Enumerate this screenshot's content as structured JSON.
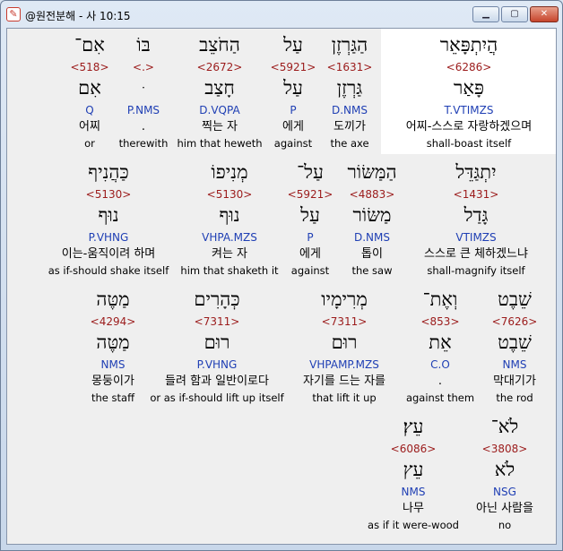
{
  "window": {
    "title": "@원전분해 - 사 10:15",
    "app_icon_glyph": "✎",
    "min_glyph": "▁",
    "max_glyph": "▢",
    "close_glyph": "✕"
  },
  "rows": [
    {
      "words": [
        {
          "hebrew": "אִם־",
          "strong": "<518>",
          "lemma": "אִם",
          "morph": "Q",
          "korean": "어찌",
          "english": "or"
        },
        {
          "hebrew": "בּוֹ",
          "strong": "<.>",
          "lemma": "ּ",
          "morph": "P.NMS",
          "korean": ".",
          "english": "therewith"
        },
        {
          "hebrew": "הַחֹצֵב",
          "strong": "<2672>",
          "lemma": "חָצַב",
          "morph": "D.VQPA",
          "korean": "찍는 자",
          "english": "him that heweth"
        },
        {
          "hebrew": "עַל",
          "strong": "<5921>",
          "lemma": "עַל",
          "morph": "P",
          "korean": "에게",
          "english": "against"
        },
        {
          "hebrew": "הַגַּרְזֶן",
          "strong": "<1631>",
          "lemma": "גַּרְזֶן",
          "morph": "D.NMS",
          "korean": "도끼가",
          "english": "the axe"
        },
        {
          "hebrew": "הֲיִתְפָּאֵר",
          "strong": "<6286>",
          "lemma": "פָּאַר",
          "morph": "T.VTIMZS",
          "korean": "어찌-스스로 자랑하겠으며",
          "english": "shall-boast itself"
        }
      ]
    },
    {
      "words": [
        {
          "hebrew": "כַּהֲנִיף",
          "strong": "<5130>",
          "lemma": "נוּף",
          "morph": "P.VHNG",
          "korean": "이는-움직이려 하며",
          "english": "as if-should shake itself"
        },
        {
          "hebrew": "מְנִיפוֹ",
          "strong": "<5130>",
          "lemma": "נוּף",
          "morph": "VHPA.MZS",
          "korean": "켜는 자",
          "english": "him that shaketh it"
        },
        {
          "hebrew": "עַל־",
          "strong": "<5921>",
          "lemma": "עַל",
          "morph": "P",
          "korean": "에게",
          "english": "against"
        },
        {
          "hebrew": "הַמַּשּׂוֹר",
          "strong": "<4883>",
          "lemma": "מַשּׂוֹר",
          "morph": "D.NMS",
          "korean": "톱이",
          "english": "the saw"
        },
        {
          "hebrew": "יִתְגַּדֵּל",
          "strong": "<1431>",
          "lemma": "גָּדַל",
          "morph": "VTIMZS",
          "korean": "스스로 큰 체하겠느냐",
          "english": "shall-magnify itself"
        }
      ]
    },
    {
      "words": [
        {
          "hebrew": "מַטֶּה",
          "strong": "<4294>",
          "lemma": "מַטֶּה",
          "morph": "NMS",
          "korean": "몽둥이가",
          "english": "the staff"
        },
        {
          "hebrew": "כְּהָרִים",
          "strong": "<7311>",
          "lemma": "רוּם",
          "morph": "P.VHNG",
          "korean": "들려 함과 일반이로다",
          "english": "or as if-should lift up itself"
        },
        {
          "hebrew": "מְרִימָיו",
          "strong": "<7311>",
          "lemma": "רוּם",
          "morph": "VHPAMP.MZS",
          "korean": "자기를 드는 자를",
          "english": "that lift it up"
        },
        {
          "hebrew": "וְאֶת־",
          "strong": "<853>",
          "lemma": "אֵת",
          "morph": "C.O",
          "korean": ".",
          "english": "against them"
        },
        {
          "hebrew": "שֵׁבֶט",
          "strong": "<7626>",
          "lemma": "שֵׁבֶט",
          "morph": "NMS",
          "korean": "막대기가",
          "english": "the rod"
        }
      ]
    },
    {
      "words": [
        {
          "hebrew": "עֵץ׃",
          "strong": "<6086>",
          "lemma": "עֵץ",
          "morph": "NMS",
          "korean": "나무",
          "english": "as if it were-wood"
        },
        {
          "hebrew": "לֹא־",
          "strong": "<3808>",
          "lemma": "לֹא",
          "morph": "NSG",
          "korean": "아닌 사람을",
          "english": "no"
        }
      ]
    }
  ],
  "colors": {
    "strong_number": "#9b1b1b",
    "morphology": "#1f3fb4",
    "highlight": "#ffffff"
  }
}
